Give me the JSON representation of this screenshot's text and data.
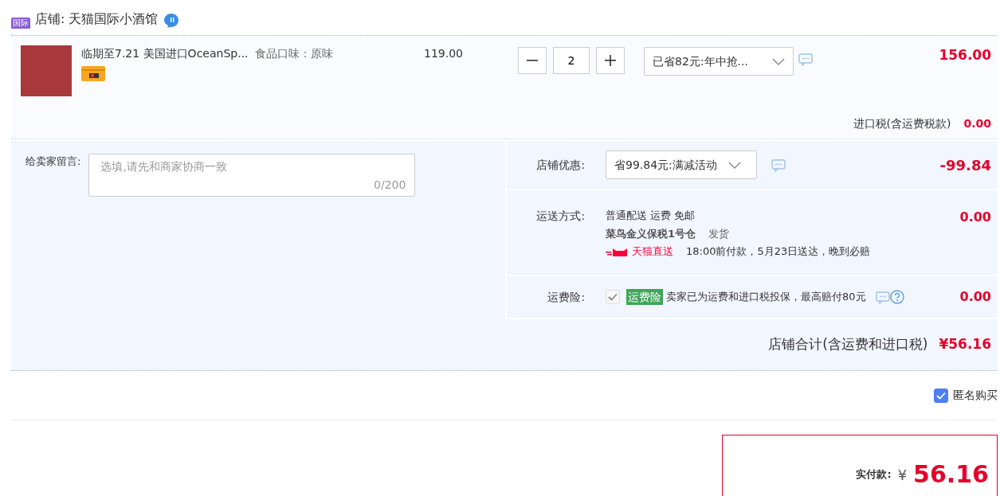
{
  "store": {
    "badge": "国际",
    "name": "店铺: 天猫国际小酒馆"
  },
  "item": {
    "title": "临期至7.21 美国进口OceanSp...",
    "attribute": "食品口味：原味",
    "price": "119.00",
    "quantity": "2",
    "promo": "已省82元:年中抢...",
    "subtotal": "156.00",
    "tax_label": "进口税(含运费税款)",
    "tax": "0.00"
  },
  "message": {
    "label": "给卖家留言:",
    "placeholder": "选填,请先和商家协商一致",
    "counter": "0/200"
  },
  "discount": {
    "label": "店铺优惠:",
    "value": "省99.84元:满减活动",
    "amount": "-99.84"
  },
  "shipping": {
    "label": "运送方式:",
    "method": "普通配送 运费 免邮",
    "warehouse": "菜鸟金义保税1号仓",
    "warehouse_suffix": "发货",
    "badge": "天猫直送",
    "eta": "18:00前付款，5月23日送达，晚到必赔",
    "amount": "0.00"
  },
  "insurance": {
    "label": "运费险:",
    "checked": true,
    "disabled": true,
    "tag": "运费险",
    "text": "卖家已为运费和进口税投保，最高赔付80元",
    "amount": "0.00"
  },
  "total": {
    "label": "店铺合计(含运费和进口税)",
    "amount": "¥56.16"
  },
  "anonymous": {
    "label": "匿名购买",
    "checked": true
  },
  "payment": {
    "label": "实付款:",
    "currency": "¥",
    "amount": "56.16"
  }
}
